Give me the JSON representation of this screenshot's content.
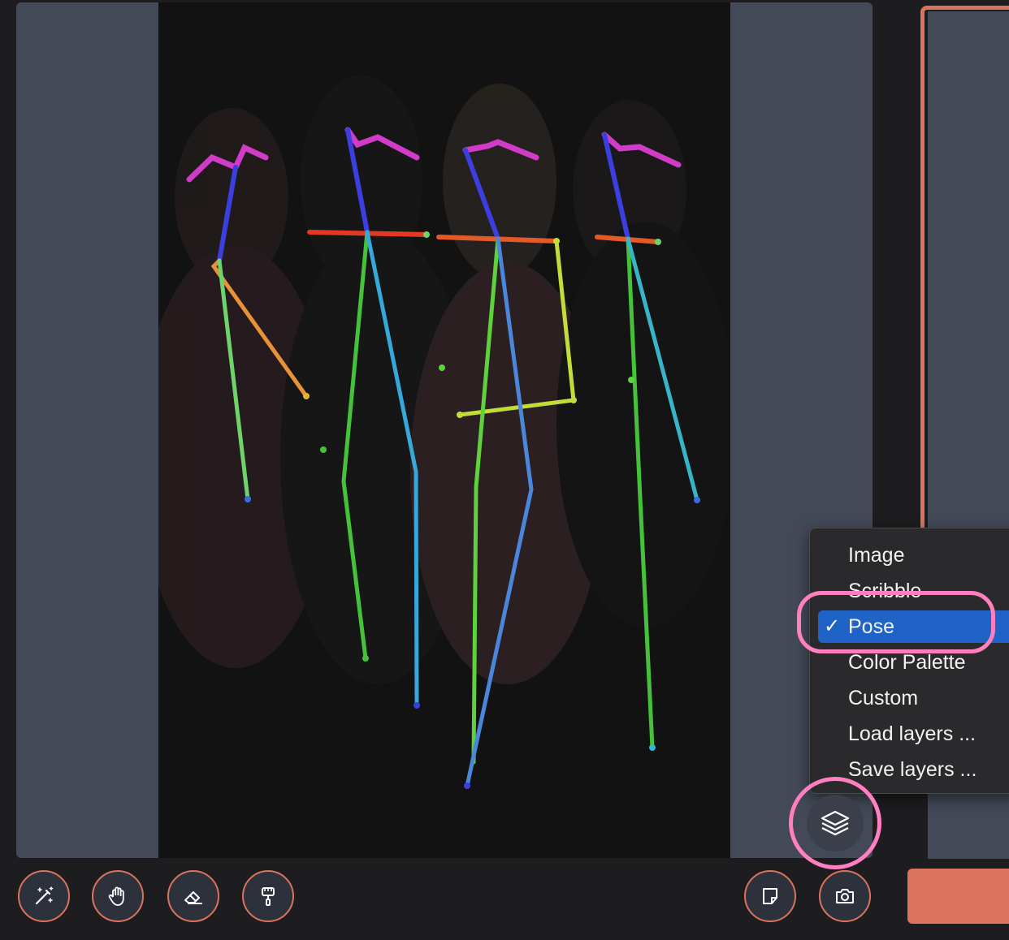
{
  "layer_menu": {
    "items": [
      {
        "label": "Image",
        "selected": false
      },
      {
        "label": "Scribble",
        "selected": false
      },
      {
        "label": "Pose",
        "selected": true
      },
      {
        "label": "Color Palette",
        "selected": false
      },
      {
        "label": "Custom",
        "selected": false
      },
      {
        "label": "Load layers ...",
        "selected": false
      },
      {
        "label": "Save layers ...",
        "selected": false
      }
    ],
    "check_glyph": "✓"
  },
  "toolbar": {
    "tools": [
      "magic-wand-icon",
      "hand-icon",
      "eraser-icon",
      "paint-roller-icon"
    ],
    "right_tools": [
      "note-icon",
      "camera-icon"
    ],
    "layers_icon": "layers-icon"
  },
  "colors": {
    "accent": "#db735e",
    "canvas_bg": "#434957",
    "menu_selected": "#1f63c7",
    "annotation": "#ff7fbf"
  }
}
